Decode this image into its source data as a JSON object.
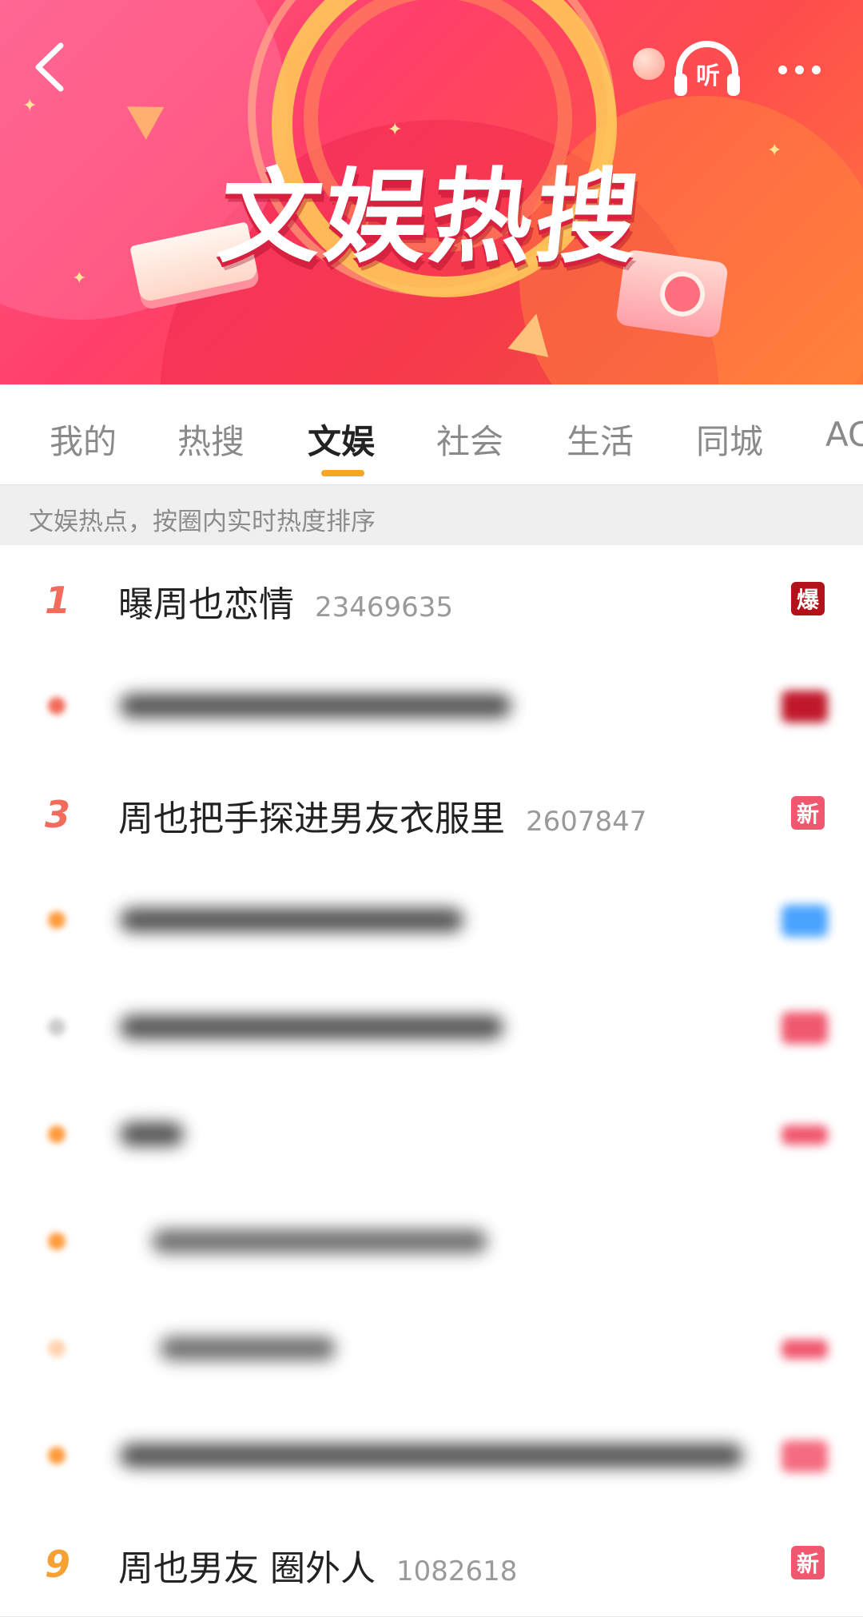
{
  "banner": {
    "title": "文娱热搜",
    "listen_label": "听",
    "colors": {
      "primary": "#ff3f6a",
      "accent": "#ffc24a"
    },
    "icons": [
      "back-arrow-icon",
      "headphones-icon",
      "more-dots-icon"
    ]
  },
  "tabs": [
    {
      "label": "我的"
    },
    {
      "label": "热搜"
    },
    {
      "label": "文娱",
      "active": true
    },
    {
      "label": "社会"
    },
    {
      "label": "生活"
    },
    {
      "label": "同城"
    },
    {
      "label": "AC"
    }
  ],
  "subheader": {
    "text": "文娱热点，按圈内实时热度排序"
  },
  "list": {
    "items": [
      {
        "rank": "1",
        "title": "曝周也恋情",
        "count": "23469635",
        "badge": "爆"
      },
      {
        "blurred": true
      },
      {
        "rank": "3",
        "title": "周也把手探进男友衣服里",
        "count": "2607847",
        "badge": "新"
      },
      {
        "blurred": true
      },
      {
        "blurred": true
      },
      {
        "blurred": true
      },
      {
        "blurred": true
      },
      {
        "blurred": true
      },
      {
        "blurred": true
      },
      {
        "rank": "9",
        "title": "周也男友 圈外人",
        "count": "1082618",
        "badge": "新"
      }
    ]
  }
}
